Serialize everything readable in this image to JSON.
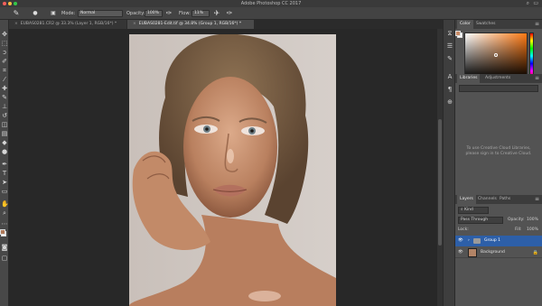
{
  "window": {
    "title": "Adobe Photoshop CC 2017",
    "traffic_colors": [
      "#fc605c",
      "#fdbc40",
      "#34c84a"
    ]
  },
  "options_bar": {
    "mode_label": "Mode:",
    "mode_value": "Normal",
    "opacity_label": "Opacity:",
    "opacity_value": "100%",
    "flow_label": "Flow:",
    "flow_value": "11%"
  },
  "tabs": [
    {
      "label": "EUBAS0281.CR2 @ 33.3% (Layer 1, RGB/16*) *",
      "active": false
    },
    {
      "label": "EUBAS0281-Edit.tif @ 34.8% (Group 1, RGB/16*) *",
      "active": true
    }
  ],
  "toolbar": {
    "tools": [
      "move-tool",
      "marquee-tool",
      "lasso-tool",
      "quick-select-tool",
      "crop-tool",
      "eyedropper-tool",
      "healing-tool",
      "brush-tool",
      "clone-stamp-tool",
      "history-brush-tool",
      "eraser-tool",
      "gradient-tool",
      "blur-tool",
      "dodge-tool",
      "pen-tool",
      "type-tool",
      "path-select-tool",
      "rectangle-tool",
      "hand-tool",
      "zoom-tool"
    ],
    "foreground_color": "#b07a5a",
    "background_color": "#ffffff"
  },
  "color_panel": {
    "tabs": [
      "Color",
      "Swatches"
    ],
    "active_tab": "Color",
    "selected_swatch": "#c98b66"
  },
  "libraries_panel": {
    "tabs": [
      "Libraries",
      "Adjustments"
    ],
    "active_tab": "Libraries",
    "message": "To use Creative Cloud Libraries, please sign in to Creative Cloud."
  },
  "layers_panel": {
    "tabs": [
      "Layers",
      "Channels",
      "Paths"
    ],
    "active_tab": "Layers",
    "filter_label": "Kind",
    "blend_mode": "Pass Through",
    "opacity_label": "Opacity:",
    "opacity_value": "100%",
    "lock_label": "Lock:",
    "fill_label": "Fill:",
    "fill_value": "100%",
    "layers": [
      {
        "name": "Group 1",
        "type": "group",
        "selected": true
      },
      {
        "name": "Background",
        "type": "image",
        "selected": false
      }
    ]
  },
  "accent": "#2d5fa8"
}
